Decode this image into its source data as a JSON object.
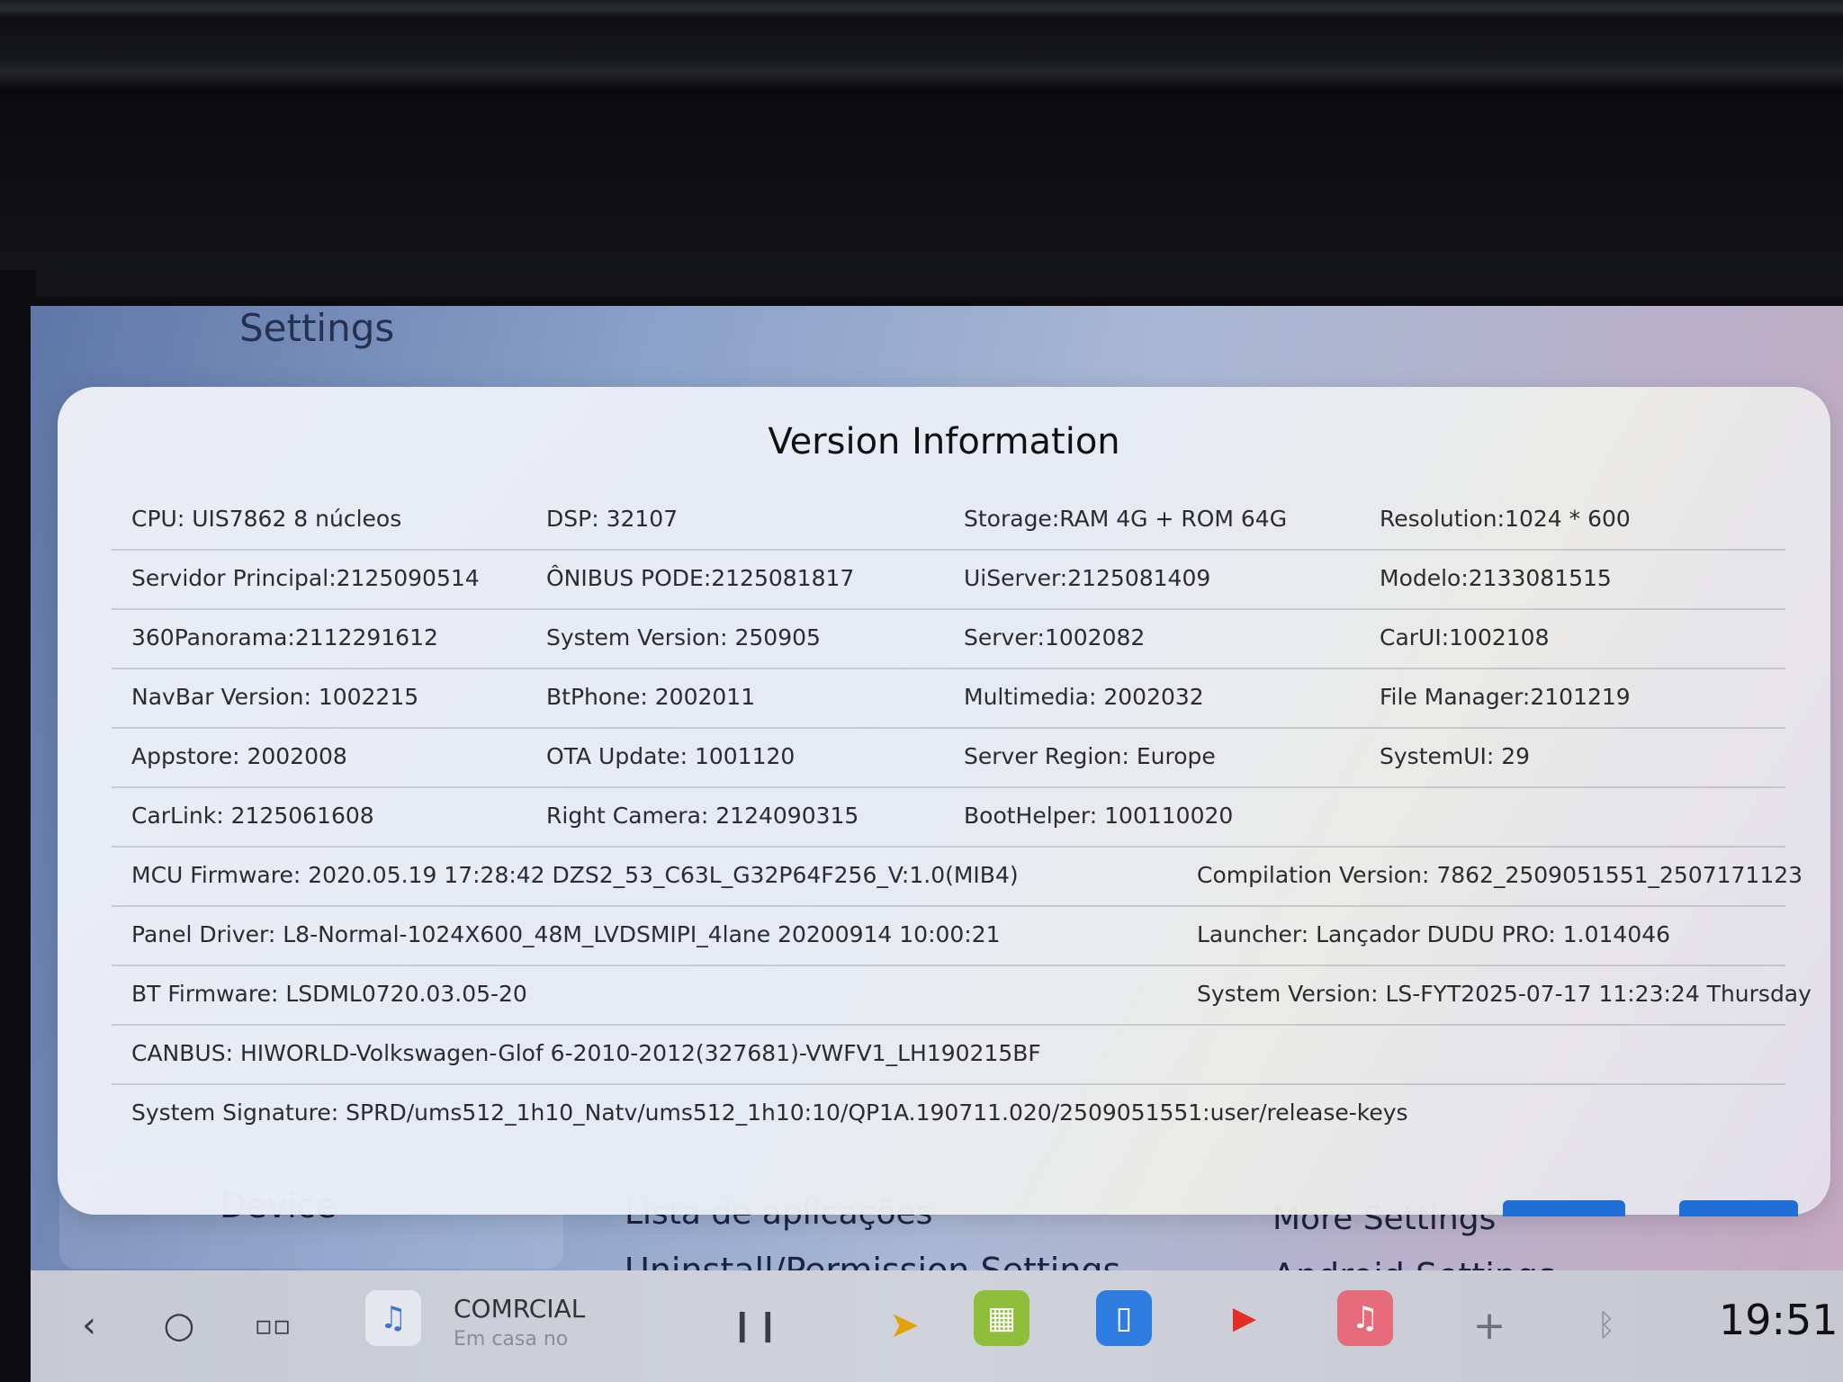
{
  "background": {
    "title": "Settings",
    "device": "Device",
    "apps_list": "Lista de aplicações",
    "uninstall": "Uninstall/Permission Settings",
    "more": "More Settings",
    "android": "Android Settings"
  },
  "dialog": {
    "title": "Version Information",
    "rows": [
      [
        "CPU:  UIS7862 8 núcleos",
        "DSP:  32107",
        "Storage:RAM 4G + ROM 64G",
        "Resolution:1024 * 600"
      ],
      [
        "Servidor Principal:2125090514",
        "ÔNIBUS PODE:2125081817",
        "UiServer:2125081409",
        "Modelo:2133081515"
      ],
      [
        "360Panorama:2112291612",
        "System Version:  250905",
        "Server:1002082",
        "CarUI:1002108"
      ],
      [
        "NavBar Version:  1002215",
        "BtPhone:  2002011",
        "Multimedia:  2002032",
        "File Manager:2101219"
      ],
      [
        "Appstore:  2002008",
        "OTA Update:  1001120",
        "Server Region:  Europe",
        "SystemUI:  29"
      ],
      [
        "CarLink:  2125061608",
        "Right Camera:  2124090315",
        "BootHelper: 100110020",
        ""
      ]
    ],
    "wide_rows": [
      [
        "MCU Firmware:  2020.05.19 17:28:42 DZS2_53_C63L_G32P64F256_V:1.0(MIB4)",
        "Compilation Version:  7862_2509051551_2507171123"
      ],
      [
        "Panel Driver:  L8-Normal-1024X600_48M_LVDSMIPI_4lane 20200914 10:00:21",
        "Launcher:  Lançador DUDU PRO: 1.014046"
      ],
      [
        "BT Firmware:  LSDML0720.03.05-20",
        "System Version:  LS-FYT2025-07-17 11:23:24 Thursday"
      ],
      [
        "CANBUS:  HIWORLD-Volkswagen-Glof 6-2010-2012(327681)-VWFV1_LH190215BF",
        ""
      ],
      [
        "System Signature:  SPRD/ums512_1h10_Natv/ums512_1h10:10/QP1A.190711.020/2509051551:user/release-keys",
        ""
      ]
    ]
  },
  "navbar": {
    "media_title": "COMRCIAL",
    "media_subtitle": "Em casa no",
    "clock": "19:51",
    "icons": {
      "back": "‹",
      "home": "○",
      "apps": "▫▫",
      "music": "♫",
      "pause": "❙❙",
      "nav": "➤",
      "grid": "▦",
      "phone": "▯",
      "youtube": "▶",
      "music_app": "♫",
      "add": "+",
      "bluetooth": "ᛒ"
    }
  }
}
